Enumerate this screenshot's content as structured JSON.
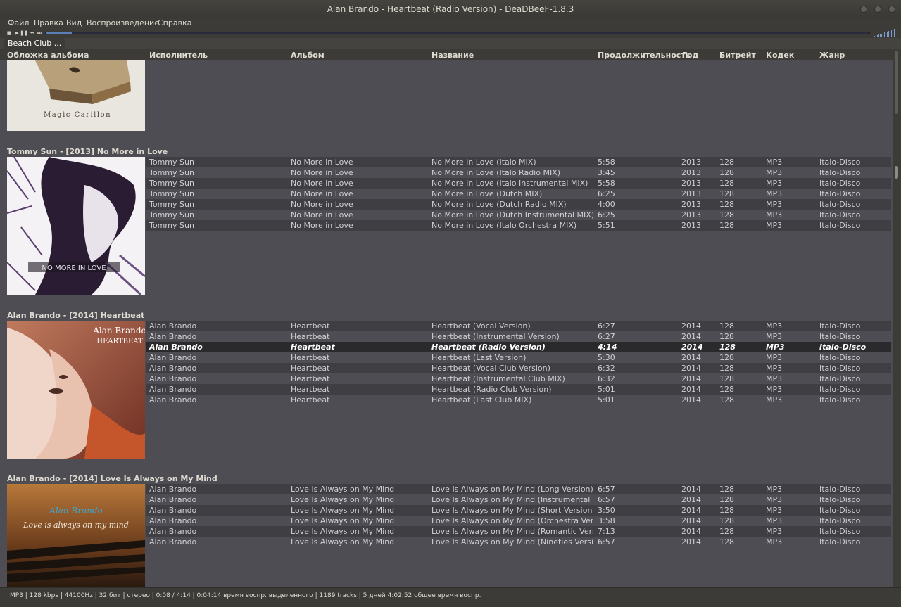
{
  "window": {
    "title": "Alan Brando - Heartbeat (Radio Version) - DeaDBeeF-1.8.3"
  },
  "menu": [
    "Файл",
    "Правка",
    "Вид",
    "Воспроизведение",
    "Справка"
  ],
  "playback": {
    "progress": 0.032,
    "volume": 1.0
  },
  "tabs": [
    "Beach Club ..."
  ],
  "columns": [
    "Обложка альбома",
    "Исполнитель",
    "Альбом",
    "Название",
    "Продолжительность",
    "Год",
    "Битрейт",
    "Кодек",
    "Жанр"
  ],
  "groups": [
    {
      "header": "",
      "art_text": "Magic Carillon",
      "tracks": []
    },
    {
      "header": "Tommy Sun - [2013] No More in Love",
      "art_text": "NO MORE IN LOVE",
      "tracks": [
        [
          "Tommy Sun",
          "No More in Love",
          "No More in Love (Italo MIX)",
          "5:58",
          "2013",
          "128",
          "MP3",
          "Italo-Disco"
        ],
        [
          "Tommy Sun",
          "No More in Love",
          "No More in Love (Italo Radio MIX)",
          "3:45",
          "2013",
          "128",
          "MP3",
          "Italo-Disco"
        ],
        [
          "Tommy Sun",
          "No More in Love",
          "No More in Love (Italo Instrumental MIX)",
          "5:58",
          "2013",
          "128",
          "MP3",
          "Italo-Disco"
        ],
        [
          "Tommy Sun",
          "No More in Love",
          "No More in Love (Dutch MIX)",
          "6:25",
          "2013",
          "128",
          "MP3",
          "Italo-Disco"
        ],
        [
          "Tommy Sun",
          "No More in Love",
          "No More in Love (Dutch Radio MIX)",
          "4:00",
          "2013",
          "128",
          "MP3",
          "Italo-Disco"
        ],
        [
          "Tommy Sun",
          "No More in Love",
          "No More in Love (Dutch Instrumental MIX)",
          "6:25",
          "2013",
          "128",
          "MP3",
          "Italo-Disco"
        ],
        [
          "Tommy Sun",
          "No More in Love",
          "No More in Love (Italo Orchestra MIX)",
          "5:51",
          "2013",
          "128",
          "MP3",
          "Italo-Disco"
        ]
      ]
    },
    {
      "header": "Alan Brando - [2014] Heartbeat",
      "art_text": "Alan Brando",
      "art_text2": "HEARTBEAT",
      "tracks": [
        [
          "Alan Brando",
          "Heartbeat",
          "Heartbeat (Vocal Version)",
          "6:27",
          "2014",
          "128",
          "MP3",
          "Italo-Disco"
        ],
        [
          "Alan Brando",
          "Heartbeat",
          "Heartbeat (Instrumental Version)",
          "6:27",
          "2014",
          "128",
          "MP3",
          "Italo-Disco"
        ],
        [
          "Alan Brando",
          "Heartbeat",
          "Heartbeat (Radio Version)",
          "4:14",
          "2014",
          "128",
          "MP3",
          "Italo-Disco"
        ],
        [
          "Alan Brando",
          "Heartbeat",
          "Heartbeat (Last Version)",
          "5:30",
          "2014",
          "128",
          "MP3",
          "Italo-Disco"
        ],
        [
          "Alan Brando",
          "Heartbeat",
          "Heartbeat (Vocal Club Version)",
          "6:32",
          "2014",
          "128",
          "MP3",
          "Italo-Disco"
        ],
        [
          "Alan Brando",
          "Heartbeat",
          "Heartbeat (Instrumental Club MIX)",
          "6:32",
          "2014",
          "128",
          "MP3",
          "Italo-Disco"
        ],
        [
          "Alan Brando",
          "Heartbeat",
          "Heartbeat (Radio Club Version)",
          "5:01",
          "2014",
          "128",
          "MP3",
          "Italo-Disco"
        ],
        [
          "Alan Brando",
          "Heartbeat",
          "Heartbeat (Last Club MIX)",
          "5:01",
          "2014",
          "128",
          "MP3",
          "Italo-Disco"
        ]
      ]
    },
    {
      "header": "Alan Brando - [2014] Love Is Always on My Mind",
      "art_text": "Alan Brando",
      "art_text2": "Love is always on my mind",
      "tracks": [
        [
          "Alan Brando",
          "Love Is Always on My Mind",
          "Love Is Always on My Mind (Long Version)",
          "6:57",
          "2014",
          "128",
          "MP3",
          "Italo-Disco"
        ],
        [
          "Alan Brando",
          "Love Is Always on My Mind",
          "Love Is Always on My Mind (Instrumental Ver...",
          "6:57",
          "2014",
          "128",
          "MP3",
          "Italo-Disco"
        ],
        [
          "Alan Brando",
          "Love Is Always on My Mind",
          "Love Is Always on My Mind (Short Version)",
          "3:50",
          "2014",
          "128",
          "MP3",
          "Italo-Disco"
        ],
        [
          "Alan Brando",
          "Love Is Always on My Mind",
          "Love Is Always on My Mind (Orchestra Version)",
          "3:58",
          "2014",
          "128",
          "MP3",
          "Italo-Disco"
        ],
        [
          "Alan Brando",
          "Love Is Always on My Mind",
          "Love Is Always on My Mind (Romantic Version)",
          "7:13",
          "2014",
          "128",
          "MP3",
          "Italo-Disco"
        ],
        [
          "Alan Brando",
          "Love Is Always on My Mind",
          "Love Is Always on My Mind (Nineties Version)",
          "6:57",
          "2014",
          "128",
          "MP3",
          "Italo-Disco"
        ]
      ]
    }
  ],
  "now_playing": {
    "group": 2,
    "track": 2
  },
  "status": "MP3 | 128 kbps | 44100Hz | 32 бит | стерео | 0:08 / 4:14 | 0:04:14 время воспр. выделенного | 1189 tracks | 5 дней 4:02:52 общее время воспр."
}
